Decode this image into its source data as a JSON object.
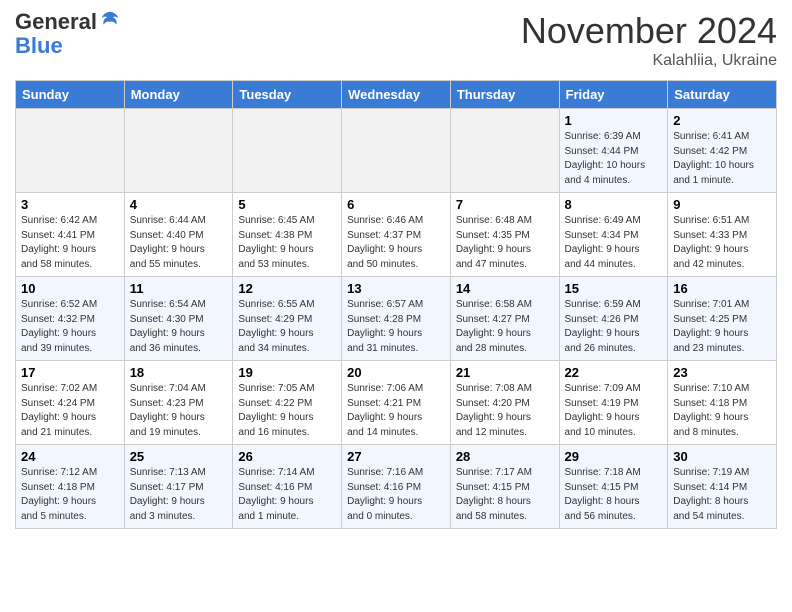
{
  "header": {
    "logo_line1": "General",
    "logo_line2": "Blue",
    "month": "November 2024",
    "location": "Kalahliia, Ukraine"
  },
  "weekdays": [
    "Sunday",
    "Monday",
    "Tuesday",
    "Wednesday",
    "Thursday",
    "Friday",
    "Saturday"
  ],
  "weeks": [
    [
      {
        "day": "",
        "info": ""
      },
      {
        "day": "",
        "info": ""
      },
      {
        "day": "",
        "info": ""
      },
      {
        "day": "",
        "info": ""
      },
      {
        "day": "",
        "info": ""
      },
      {
        "day": "1",
        "info": "Sunrise: 6:39 AM\nSunset: 4:44 PM\nDaylight: 10 hours\nand 4 minutes."
      },
      {
        "day": "2",
        "info": "Sunrise: 6:41 AM\nSunset: 4:42 PM\nDaylight: 10 hours\nand 1 minute."
      }
    ],
    [
      {
        "day": "3",
        "info": "Sunrise: 6:42 AM\nSunset: 4:41 PM\nDaylight: 9 hours\nand 58 minutes."
      },
      {
        "day": "4",
        "info": "Sunrise: 6:44 AM\nSunset: 4:40 PM\nDaylight: 9 hours\nand 55 minutes."
      },
      {
        "day": "5",
        "info": "Sunrise: 6:45 AM\nSunset: 4:38 PM\nDaylight: 9 hours\nand 53 minutes."
      },
      {
        "day": "6",
        "info": "Sunrise: 6:46 AM\nSunset: 4:37 PM\nDaylight: 9 hours\nand 50 minutes."
      },
      {
        "day": "7",
        "info": "Sunrise: 6:48 AM\nSunset: 4:35 PM\nDaylight: 9 hours\nand 47 minutes."
      },
      {
        "day": "8",
        "info": "Sunrise: 6:49 AM\nSunset: 4:34 PM\nDaylight: 9 hours\nand 44 minutes."
      },
      {
        "day": "9",
        "info": "Sunrise: 6:51 AM\nSunset: 4:33 PM\nDaylight: 9 hours\nand 42 minutes."
      }
    ],
    [
      {
        "day": "10",
        "info": "Sunrise: 6:52 AM\nSunset: 4:32 PM\nDaylight: 9 hours\nand 39 minutes."
      },
      {
        "day": "11",
        "info": "Sunrise: 6:54 AM\nSunset: 4:30 PM\nDaylight: 9 hours\nand 36 minutes."
      },
      {
        "day": "12",
        "info": "Sunrise: 6:55 AM\nSunset: 4:29 PM\nDaylight: 9 hours\nand 34 minutes."
      },
      {
        "day": "13",
        "info": "Sunrise: 6:57 AM\nSunset: 4:28 PM\nDaylight: 9 hours\nand 31 minutes."
      },
      {
        "day": "14",
        "info": "Sunrise: 6:58 AM\nSunset: 4:27 PM\nDaylight: 9 hours\nand 28 minutes."
      },
      {
        "day": "15",
        "info": "Sunrise: 6:59 AM\nSunset: 4:26 PM\nDaylight: 9 hours\nand 26 minutes."
      },
      {
        "day": "16",
        "info": "Sunrise: 7:01 AM\nSunset: 4:25 PM\nDaylight: 9 hours\nand 23 minutes."
      }
    ],
    [
      {
        "day": "17",
        "info": "Sunrise: 7:02 AM\nSunset: 4:24 PM\nDaylight: 9 hours\nand 21 minutes."
      },
      {
        "day": "18",
        "info": "Sunrise: 7:04 AM\nSunset: 4:23 PM\nDaylight: 9 hours\nand 19 minutes."
      },
      {
        "day": "19",
        "info": "Sunrise: 7:05 AM\nSunset: 4:22 PM\nDaylight: 9 hours\nand 16 minutes."
      },
      {
        "day": "20",
        "info": "Sunrise: 7:06 AM\nSunset: 4:21 PM\nDaylight: 9 hours\nand 14 minutes."
      },
      {
        "day": "21",
        "info": "Sunrise: 7:08 AM\nSunset: 4:20 PM\nDaylight: 9 hours\nand 12 minutes."
      },
      {
        "day": "22",
        "info": "Sunrise: 7:09 AM\nSunset: 4:19 PM\nDaylight: 9 hours\nand 10 minutes."
      },
      {
        "day": "23",
        "info": "Sunrise: 7:10 AM\nSunset: 4:18 PM\nDaylight: 9 hours\nand 8 minutes."
      }
    ],
    [
      {
        "day": "24",
        "info": "Sunrise: 7:12 AM\nSunset: 4:18 PM\nDaylight: 9 hours\nand 5 minutes."
      },
      {
        "day": "25",
        "info": "Sunrise: 7:13 AM\nSunset: 4:17 PM\nDaylight: 9 hours\nand 3 minutes."
      },
      {
        "day": "26",
        "info": "Sunrise: 7:14 AM\nSunset: 4:16 PM\nDaylight: 9 hours\nand 1 minute."
      },
      {
        "day": "27",
        "info": "Sunrise: 7:16 AM\nSunset: 4:16 PM\nDaylight: 9 hours\nand 0 minutes."
      },
      {
        "day": "28",
        "info": "Sunrise: 7:17 AM\nSunset: 4:15 PM\nDaylight: 8 hours\nand 58 minutes."
      },
      {
        "day": "29",
        "info": "Sunrise: 7:18 AM\nSunset: 4:15 PM\nDaylight: 8 hours\nand 56 minutes."
      },
      {
        "day": "30",
        "info": "Sunrise: 7:19 AM\nSunset: 4:14 PM\nDaylight: 8 hours\nand 54 minutes."
      }
    ]
  ]
}
